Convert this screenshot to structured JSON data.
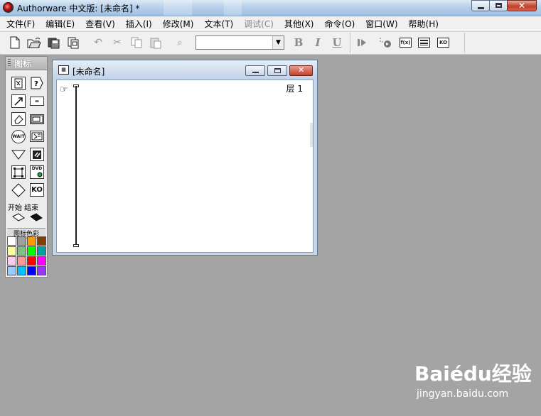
{
  "window": {
    "title": "Authorware 中文版: [未命名] *"
  },
  "menubar": {
    "items": [
      {
        "label": "文件(F)",
        "enabled": true
      },
      {
        "label": "编辑(E)",
        "enabled": true
      },
      {
        "label": "查看(V)",
        "enabled": true
      },
      {
        "label": "插入(I)",
        "enabled": true
      },
      {
        "label": "修改(M)",
        "enabled": true
      },
      {
        "label": "文本(T)",
        "enabled": true
      },
      {
        "label": "调试(C)",
        "enabled": false
      },
      {
        "label": "其他(X)",
        "enabled": true
      },
      {
        "label": "命令(O)",
        "enabled": true
      },
      {
        "label": "窗口(W)",
        "enabled": true
      },
      {
        "label": "帮助(H)",
        "enabled": true
      }
    ]
  },
  "toolbar": {
    "font_combo_value": "",
    "bold_label": "B",
    "italic_label": "I",
    "underline_label": "U",
    "functions_label": "f(x)",
    "ko_label": "KO"
  },
  "palette": {
    "title": "图标",
    "start_end_label": "开始 结束",
    "colors_label": "图标色彩",
    "icons": [
      "display-icon",
      "interaction-icon",
      "motion-icon",
      "calculation-icon",
      "erase-icon",
      "map-icon",
      "wait-icon",
      "digital-movie-icon",
      "navigate-icon",
      "sound-icon",
      "framework-icon",
      "video-icon",
      "decision-icon",
      "knowledge-object-icon"
    ],
    "icon_labels": {
      "wait": "WAIT",
      "dvd": "DVD",
      "ko": "KO",
      "calc": "="
    },
    "swatch_colors": [
      "#ffffff",
      "#a0a0a0",
      "#ff9900",
      "#804000",
      "#ffff99",
      "#80c080",
      "#00ff00",
      "#00a0a0",
      "#ffccee",
      "#ff9999",
      "#ff0000",
      "#ff00ff",
      "#99ccff",
      "#00c0ff",
      "#0000ff",
      "#9933ff"
    ]
  },
  "design_window": {
    "title": "[未命名]",
    "layer_label": "层 1"
  },
  "watermark": {
    "logo": "Baiédu经验",
    "url": "jingyan.baidu.com"
  }
}
